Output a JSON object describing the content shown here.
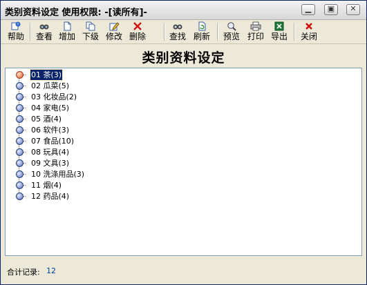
{
  "window": {
    "title": "类别资料设定 使用权限: -[读所有]-",
    "controls": [
      "minimize",
      "maximize",
      "close"
    ]
  },
  "toolbar": {
    "buttons": [
      {
        "label": "帮助",
        "icon": "help-icon"
      },
      {
        "label": "查看",
        "icon": "view-icon"
      },
      {
        "label": "增加",
        "icon": "add-icon"
      },
      {
        "label": "下级",
        "icon": "sublevel-icon"
      },
      {
        "label": "修改",
        "icon": "edit-icon"
      },
      {
        "label": "删除",
        "icon": "delete-icon"
      },
      {
        "label": "查找",
        "icon": "find-icon"
      },
      {
        "label": "刷新",
        "icon": "refresh-icon"
      },
      {
        "label": "预览",
        "icon": "preview-icon"
      },
      {
        "label": "打印",
        "icon": "print-icon"
      },
      {
        "label": "导出",
        "icon": "export-icon"
      },
      {
        "label": "关闭",
        "icon": "close-icon"
      }
    ]
  },
  "header": {
    "title": "类别资料设定"
  },
  "tree": {
    "selected_index": 0,
    "items": [
      "01 茶(3)",
      "02 瓜菜(5)",
      "03 化妆品(2)",
      "04 家电(5)",
      "05 酒(4)",
      "06 软件(3)",
      "07 食品(10)",
      "08 玩具(4)",
      "09 文具(3)",
      "10 洗涤用品(3)",
      "11 烟(4)",
      "12 药品(4)"
    ]
  },
  "status": {
    "label": "合计记录:",
    "value": "12"
  },
  "colors": {
    "selection": "#0a246a",
    "status_value": "#0040a0",
    "window_bg": "#ece9d8"
  }
}
